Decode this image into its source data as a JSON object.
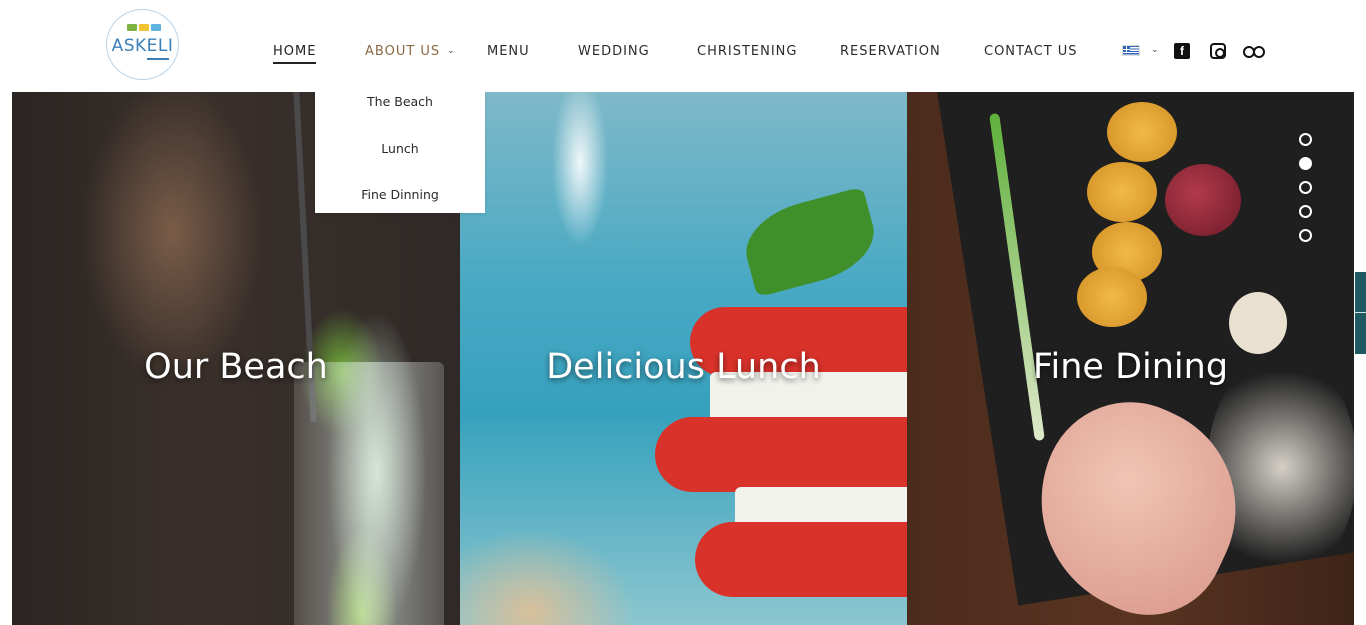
{
  "brand": {
    "logo_text": "ASKELI",
    "colors": {
      "logo_blue": "#3a7fb8",
      "logo_green": "#7db340",
      "logo_yellow": "#f0c330",
      "logo_light_blue": "#5fb5e0"
    }
  },
  "nav": {
    "items": [
      {
        "label": "HOME",
        "state": "active"
      },
      {
        "label": "ABOUT US",
        "state": "open"
      },
      {
        "label": "MENU"
      },
      {
        "label": "WEDDING"
      },
      {
        "label": "CHRISTENING"
      },
      {
        "label": "RESERVATION"
      },
      {
        "label": "CONTACT US"
      }
    ],
    "language_icon": "greek-flag-icon",
    "social_icons": [
      "facebook-icon",
      "instagram-icon",
      "tripadvisor-icon"
    ]
  },
  "dropdown": {
    "items": [
      "The Beach",
      "Lunch",
      "Fine Dinning"
    ]
  },
  "panels": [
    {
      "title": "Our Beach"
    },
    {
      "title": "Delicious Lunch"
    },
    {
      "title": "Fine Dining"
    }
  ],
  "slider": {
    "count": 5,
    "active_index": 2
  },
  "colors": {
    "accent_brown": "#8b6a44",
    "side_tab": "#1f5a63"
  }
}
